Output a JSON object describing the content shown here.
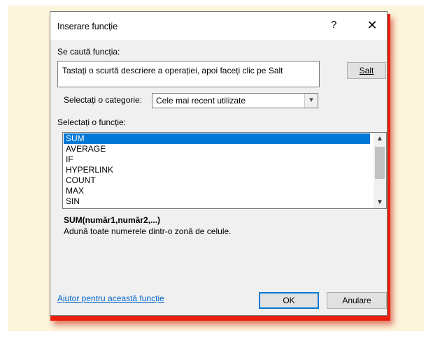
{
  "dialog": {
    "title": "Inserare funcție",
    "help": "?",
    "close": "✕"
  },
  "search": {
    "label": "Se caută funcția:",
    "value": "Tastați o scurtă descriere a operației, apoi faceți clic pe Salt",
    "go_button": "Salt"
  },
  "category": {
    "label": "Selectați o categorie:",
    "selected": "Cele mai recent utilizate"
  },
  "functions": {
    "label": "Selectați o funcție:",
    "items": [
      "SUM",
      "AVERAGE",
      "IF",
      "HYPERLINK",
      "COUNT",
      "MAX",
      "SIN"
    ],
    "selected_index": 0
  },
  "details": {
    "syntax": "SUM(număr1,număr2,...)",
    "description": "Adună toate numerele dintr-o zonă de celule."
  },
  "footer": {
    "help_link": "Ajutor pentru această funcție",
    "ok": "OK",
    "cancel": "Anulare"
  }
}
